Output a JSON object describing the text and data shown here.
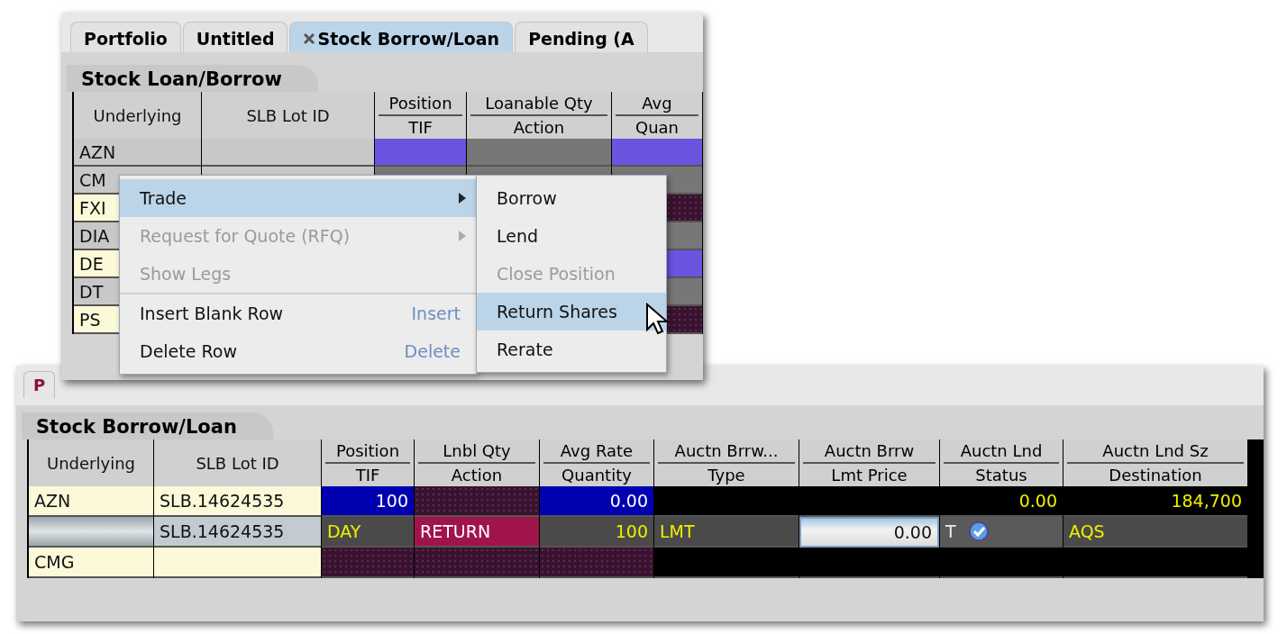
{
  "top_window": {
    "tabs": [
      {
        "label": "Portfolio",
        "selected": false,
        "closable": false
      },
      {
        "label": "Untitled",
        "selected": false,
        "closable": false
      },
      {
        "label": "Stock Borrow/Loan",
        "selected": true,
        "closable": true
      },
      {
        "label": "Pending (A",
        "selected": false,
        "closable": false
      }
    ],
    "section_title": "Stock Loan/Borrow",
    "columns": [
      {
        "top": "Underlying"
      },
      {
        "top": "SLB Lot ID"
      },
      {
        "top": "Position",
        "bottom": "TIF"
      },
      {
        "top": "Loanable Qty",
        "bottom": "Action"
      },
      {
        "top": "Avg",
        "bottom": "Quan"
      }
    ],
    "rows": [
      {
        "cells": [
          {
            "kind": "grey",
            "text": "AZN"
          },
          {
            "kind": "grey"
          },
          {
            "kind": "purple"
          },
          {
            "kind": "dim"
          },
          {
            "kind": "purple"
          }
        ]
      },
      {
        "cells": [
          {
            "kind": "grey",
            "text": "CM"
          },
          {
            "kind": "grey"
          },
          {
            "kind": "dim"
          },
          {
            "kind": "dim"
          },
          {
            "kind": "dim"
          }
        ]
      },
      {
        "cells": [
          {
            "kind": "yellow",
            "text": "FXI"
          },
          {
            "kind": "yellow"
          },
          {
            "kind": "maroon"
          },
          {
            "kind": "maroon"
          },
          {
            "kind": "maroon"
          }
        ]
      },
      {
        "cells": [
          {
            "kind": "grey",
            "text": "DIA"
          },
          {
            "kind": "grey"
          },
          {
            "kind": "dim"
          },
          {
            "kind": "dim"
          },
          {
            "kind": "dim"
          }
        ]
      },
      {
        "cells": [
          {
            "kind": "yellow",
            "text": "DE"
          },
          {
            "kind": "yellow"
          },
          {
            "kind": "maroon"
          },
          {
            "kind": "maroon"
          },
          {
            "kind": "purple"
          }
        ]
      },
      {
        "cells": [
          {
            "kind": "grey",
            "text": "DT"
          },
          {
            "kind": "grey"
          },
          {
            "kind": "dim"
          },
          {
            "kind": "dim"
          },
          {
            "kind": "dim"
          }
        ]
      },
      {
        "cells": [
          {
            "kind": "yellow",
            "text": "PS"
          },
          {
            "kind": "yellow"
          },
          {
            "kind": "maroon"
          },
          {
            "kind": "maroon"
          },
          {
            "kind": "maroon"
          }
        ]
      }
    ],
    "context_menu": {
      "items": [
        {
          "label": "Trade",
          "submenu": true,
          "disabled": false,
          "selected": true,
          "separator_before": false
        },
        {
          "label": "Request for Quote (RFQ)",
          "submenu": true,
          "disabled": true,
          "selected": false,
          "separator_before": false
        },
        {
          "label": "Show Legs",
          "submenu": false,
          "disabled": true,
          "selected": false,
          "separator_before": false
        },
        {
          "label": "Insert Blank Row",
          "shortcut": "Insert",
          "submenu": false,
          "disabled": false,
          "selected": false,
          "separator_before": true
        },
        {
          "label": "Delete Row",
          "shortcut": "Delete",
          "submenu": false,
          "disabled": false,
          "selected": false,
          "separator_before": false
        }
      ],
      "submenu": [
        {
          "label": "Borrow",
          "disabled": false,
          "selected": false
        },
        {
          "label": "Lend",
          "disabled": false,
          "selected": false
        },
        {
          "label": "Close Position",
          "disabled": true,
          "selected": false
        },
        {
          "label": "Return Shares",
          "disabled": false,
          "selected": true
        },
        {
          "label": "Rerate",
          "disabled": false,
          "selected": false
        }
      ]
    }
  },
  "bottom_window": {
    "tab": "P",
    "section_title": "Stock Borrow/Loan",
    "columns": [
      {
        "top": "Underlying"
      },
      {
        "top": "SLB Lot ID"
      },
      {
        "top": "Position",
        "bottom": "TIF"
      },
      {
        "top": "Lnbl Qty",
        "bottom": "Action"
      },
      {
        "top": "Avg Rate",
        "bottom": "Quantity"
      },
      {
        "top": "Auctn Brrw...",
        "bottom": "Type"
      },
      {
        "top": "Auctn Brrw",
        "bottom": "Lmt Price"
      },
      {
        "top": "Auctn Lnd",
        "bottom": "Status"
      },
      {
        "top": "Auctn Lnd Sz",
        "bottom": "Destination"
      }
    ],
    "rows": [
      {
        "cells": [
          {
            "kind": "yellow",
            "text": "AZN"
          },
          {
            "kind": "yellow",
            "text": "SLB.14624535"
          },
          {
            "kind": "blue",
            "text": "100"
          },
          {
            "kind": "maroon"
          },
          {
            "kind": "blue",
            "text": "0.00"
          },
          {
            "kind": "black"
          },
          {
            "kind": "black"
          },
          {
            "kind": "black",
            "text": "0.00"
          },
          {
            "kind": "black",
            "text": "184,700"
          }
        ]
      },
      {
        "cells": [
          {
            "kind": "bar"
          },
          {
            "kind": "lightgrey",
            "text": "SLB.14624535"
          },
          {
            "kind": "dark",
            "text": "DAY"
          },
          {
            "kind": "magenta",
            "text": "RETURN"
          },
          {
            "kind": "dark",
            "text": "100"
          },
          {
            "kind": "dark",
            "text": "LMT"
          },
          {
            "kind": "input",
            "text": "0.00"
          },
          {
            "kind": "status",
            "text": "T"
          },
          {
            "kind": "dark",
            "text": "AQS"
          }
        ]
      },
      {
        "cells": [
          {
            "kind": "yellow",
            "text": "CMG"
          },
          {
            "kind": "yellow"
          },
          {
            "kind": "maroon"
          },
          {
            "kind": "maroon"
          },
          {
            "kind": "maroon"
          },
          {
            "kind": "black"
          },
          {
            "kind": "black"
          },
          {
            "kind": "black"
          },
          {
            "kind": "black"
          }
        ]
      }
    ]
  }
}
